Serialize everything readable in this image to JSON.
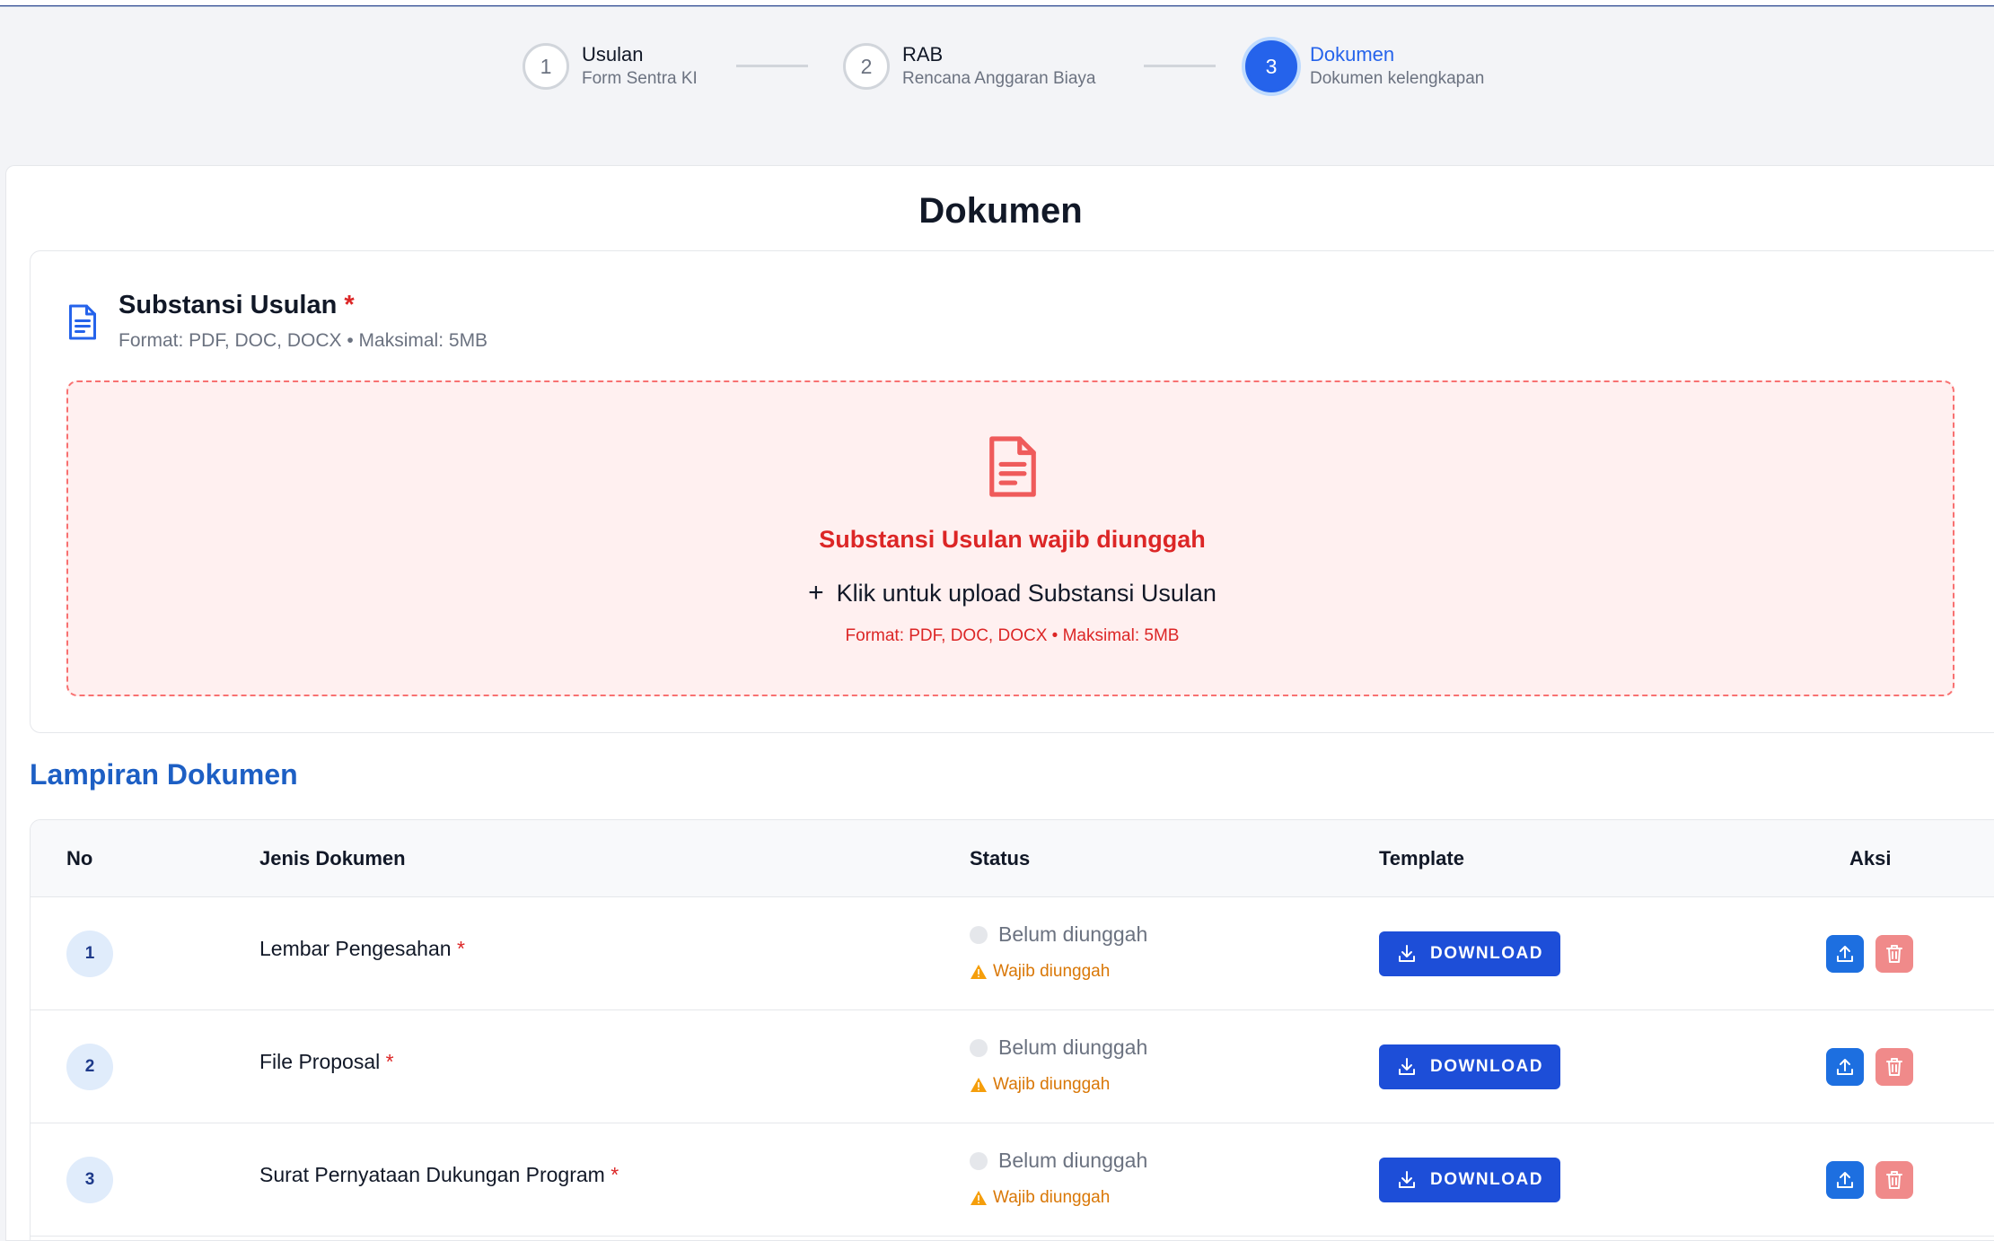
{
  "stepper": {
    "steps": [
      {
        "number": "1",
        "title": "Usulan",
        "subtitle": "Form Sentra KI"
      },
      {
        "number": "2",
        "title": "RAB",
        "subtitle": "Rencana Anggaran Biaya"
      },
      {
        "number": "3",
        "title": "Dokumen",
        "subtitle": "Dokumen kelengkapan"
      }
    ],
    "active_step": 3
  },
  "page": {
    "title": "Dokumen"
  },
  "substansi": {
    "title": "Substansi Usulan",
    "required_mark": "*",
    "format_info": "Format: PDF, DOC, DOCX • Maksimal: 5MB",
    "dropzone": {
      "error": "Substansi Usulan wajib diunggah",
      "plus": "+",
      "cta": "Klik untuk upload Substansi Usulan",
      "format_info": "Format: PDF, DOC, DOCX • Maksimal: 5MB"
    }
  },
  "lampiran": {
    "title": "Lampiran Dokumen",
    "columns": {
      "no": "No",
      "jenis": "Jenis Dokumen",
      "status": "Status",
      "template": "Template",
      "aksi": "Aksi"
    },
    "rows": [
      {
        "no": "1",
        "name": "Lembar Pengesahan",
        "required_mark": "*",
        "status": "Belum diunggah",
        "warning": "Wajib diunggah",
        "download_label": "DOWNLOAD"
      },
      {
        "no": "2",
        "name": "File Proposal",
        "required_mark": "*",
        "status": "Belum diunggah",
        "warning": "Wajib diunggah",
        "download_label": "DOWNLOAD"
      },
      {
        "no": "3",
        "name": "Surat Pernyataan Dukungan Program",
        "required_mark": "*",
        "status": "Belum diunggah",
        "warning": "Wajib diunggah",
        "download_label": "DOWNLOAD"
      }
    ]
  },
  "colors": {
    "primary": "#1d4ed8",
    "active_step": "#2563eb",
    "section_title": "#1d5fc4",
    "error": "#dc2626",
    "warning": "#d97706",
    "delete_button": "#f08a8a",
    "dropzone_bg": "#fff0f0"
  },
  "icons": {
    "substansi": "file-text-icon",
    "dropzone": "file-text-icon",
    "warning": "warning-triangle-icon",
    "download": "download-icon",
    "upload": "upload-icon",
    "delete": "trash-icon"
  }
}
